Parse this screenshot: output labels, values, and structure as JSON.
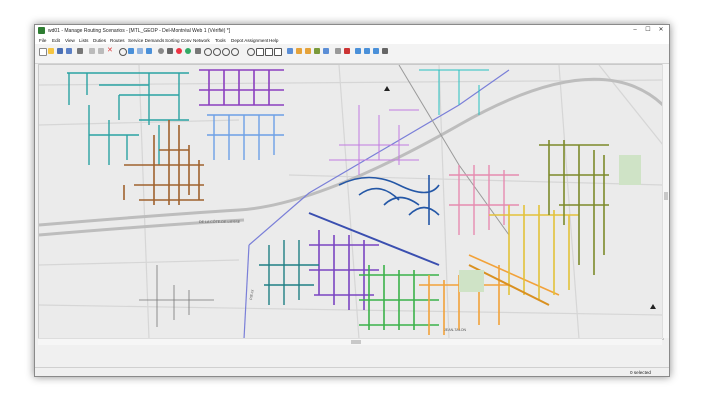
{
  "window": {
    "title": "wd01 - Manage Routing Scenarios - [MTL_GEOP - Del-Montréal Web 1 (Vérifié) *]",
    "controls": {
      "minimize": "–",
      "maximize": "☐",
      "close": "✕"
    }
  },
  "menu": {
    "items": [
      "File",
      "Edit",
      "View",
      "Lists",
      "Duties",
      "Routes",
      "Service Demands",
      "Sorting Conv",
      "Network",
      "Tools",
      "Depot Assignment",
      "Help"
    ]
  },
  "toolbar": {
    "icons": [
      "new-icon",
      "open-icon",
      "save-icon",
      "save-as-icon",
      "print-icon",
      "undo-icon",
      "redo-icon",
      "delete-icon",
      "search-icon",
      "select-icon",
      "layers-icon",
      "table-icon",
      "color-icon",
      "map-icon",
      "zoom-in-icon",
      "zoom-out-icon",
      "zoom-extent-icon",
      "zoom-prev-icon",
      "pan-icon",
      "info-icon",
      "grid-icon",
      "chart-icon",
      "route-icon",
      "build-icon",
      "balance-icon",
      "sequence-icon",
      "stats-icon",
      "tools-icon",
      "filter-icon",
      "sort-icon",
      "funnel-icon",
      "pin-icon"
    ]
  },
  "map": {
    "road_labels": [
      "DE LA CÔTE-DE-LIESSE",
      "JEAN-TALON",
      "PIE-IX"
    ],
    "route_colors": {
      "teal": "#2aa3a3",
      "purple": "#8b3fbf",
      "blue_light": "#6da0e6",
      "brown": "#a0622e",
      "magenta": "#c27be0",
      "cyan": "#27c1c1",
      "navy": "#2457a6",
      "violet": "#7b45c2",
      "green": "#3bb24a",
      "orange": "#f2a23a",
      "pink": "#e68bb0",
      "gold": "#e3c23a",
      "olive": "#7d8a2b",
      "dark_teal": "#1f7f84"
    }
  },
  "status": {
    "selection": "0 selected"
  }
}
